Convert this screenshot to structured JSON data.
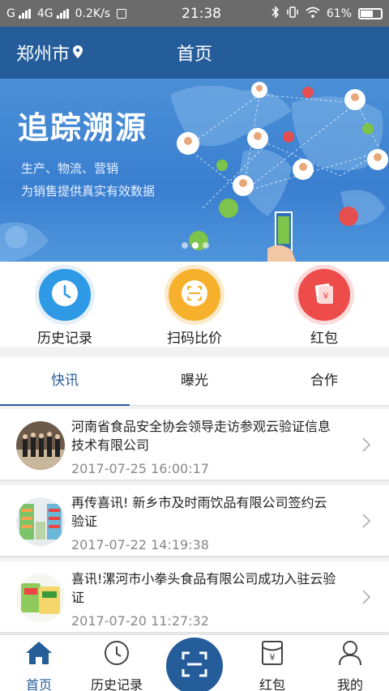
{
  "status_bar": {
    "carrier1": "G",
    "carrier2": "4G",
    "speed": "0.2K/s",
    "time": "21:38",
    "battery": "61%",
    "battery_level": 0.61
  },
  "header": {
    "city": "郑州市",
    "title": "首页"
  },
  "banner": {
    "title": "追踪溯源",
    "line1": "生产、物流、营销",
    "line2": "为销售提供真实有效数据",
    "page_count": 3,
    "active_index": 1
  },
  "quick_actions": [
    {
      "label": "历史记录",
      "icon": "clock-icon",
      "color": "#2e9ae6"
    },
    {
      "label": "扫码比价",
      "icon": "scan-icon",
      "color": "#f6b02c"
    },
    {
      "label": "红包",
      "icon": "red-envelope-icon",
      "color": "#ee4b4b"
    }
  ],
  "tabs": [
    {
      "label": "快讯",
      "active": true
    },
    {
      "label": "曝光",
      "active": false
    },
    {
      "label": "合作",
      "active": false
    }
  ],
  "news": [
    {
      "title": "河南省食品安全协会领导走访参观云验证信息技术有限公司",
      "date": "2017-07-25 16:00:17"
    },
    {
      "title": "再传喜讯! 新乡市及时雨饮品有限公司签约云验证",
      "date": "2017-07-22 14:19:38"
    },
    {
      "title": "喜讯!漯河市小拳头食品有限公司成功入驻云验证",
      "date": "2017-07-20 11:27:32"
    }
  ],
  "bottom_nav": [
    {
      "label": "首页",
      "icon": "home-icon",
      "active": true
    },
    {
      "label": "历史记录",
      "icon": "clock-icon",
      "active": false
    },
    {
      "label": "",
      "icon": "scan-icon",
      "active": false
    },
    {
      "label": "红包",
      "icon": "red-envelope-icon",
      "active": false
    },
    {
      "label": "我的",
      "icon": "user-icon",
      "active": false
    }
  ],
  "colors": {
    "primary": "#255d9a",
    "status_bar": "#6b6b6b"
  }
}
